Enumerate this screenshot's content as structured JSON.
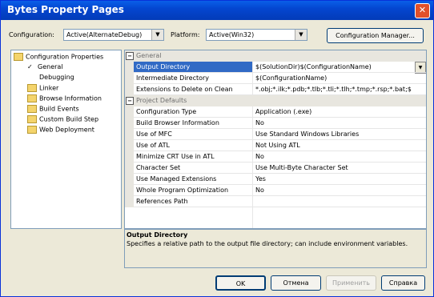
{
  "window": {
    "title": "Bytes Property Pages",
    "close_glyph": "✕"
  },
  "config": {
    "configuration_label": "Configuration:",
    "configuration_value": "Active(AlternateDebug)",
    "platform_label": "Platform:",
    "platform_value": "Active(Win32)",
    "manager_button": "Configuration Manager..."
  },
  "tree": {
    "root": "Configuration Properties",
    "items": [
      "General",
      "Debugging",
      "Linker",
      "Browse Information",
      "Build Events",
      "Custom Build Step",
      "Web Deployment"
    ],
    "selected": "General"
  },
  "grid": {
    "category_general": "General",
    "general_rows": [
      {
        "name": "Output Directory",
        "value": "$(SolutionDir)$(ConfigurationName)"
      },
      {
        "name": "Intermediate Directory",
        "value": "$(ConfigurationName)"
      },
      {
        "name": "Extensions to Delete on Clean",
        "value": "*.obj;*.ilk;*.pdb;*.tlb;*.tli;*.tlh;*.tmp;*.rsp;*.bat;$"
      }
    ],
    "category_defaults": "Project Defaults",
    "default_rows": [
      {
        "name": "Configuration Type",
        "value": "Application (.exe)"
      },
      {
        "name": "Build Browser Information",
        "value": "No"
      },
      {
        "name": "Use of MFC",
        "value": "Use Standard Windows Libraries"
      },
      {
        "name": "Use of ATL",
        "value": "Not Using ATL"
      },
      {
        "name": "Minimize CRT Use in ATL",
        "value": "No"
      },
      {
        "name": "Character Set",
        "value": "Use Multi-Byte Character Set"
      },
      {
        "name": "Use Managed Extensions",
        "value": "Yes"
      },
      {
        "name": "Whole Program Optimization",
        "value": "No"
      },
      {
        "name": "References Path",
        "value": ""
      }
    ]
  },
  "description": {
    "title": "Output Directory",
    "text": "Specifies a relative path to the output file directory; can include environment variables."
  },
  "buttons": {
    "ok": "OK",
    "cancel": "Отмена",
    "apply": "Применить",
    "help": "Справка"
  },
  "colors": {
    "title_bar": "#0446d0",
    "selection": "#316ac5",
    "dialog_bg": "#ece9d8"
  }
}
